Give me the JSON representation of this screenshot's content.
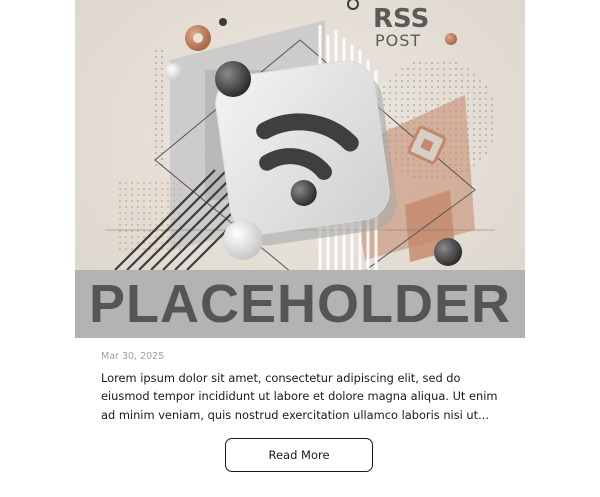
{
  "hero": {
    "logo_line1": "RSS",
    "logo_line2": "POST",
    "placeholder": "PLACEHOLDER",
    "colors": {
      "background": "#e6e0d8",
      "accent": "#c4876a",
      "band": "#b3b3b3",
      "band_text": "#555555"
    }
  },
  "post": {
    "date": "Mar 30, 2025",
    "excerpt": "Lorem ipsum dolor sit amet, consectetur adipiscing elit, sed do eiusmod tempor incididunt ut labore et dolore magna aliqua. Ut enim ad minim veniam, quis nostrud exercitation ullamco laboris nisi ut...",
    "read_more_label": "Read More"
  }
}
